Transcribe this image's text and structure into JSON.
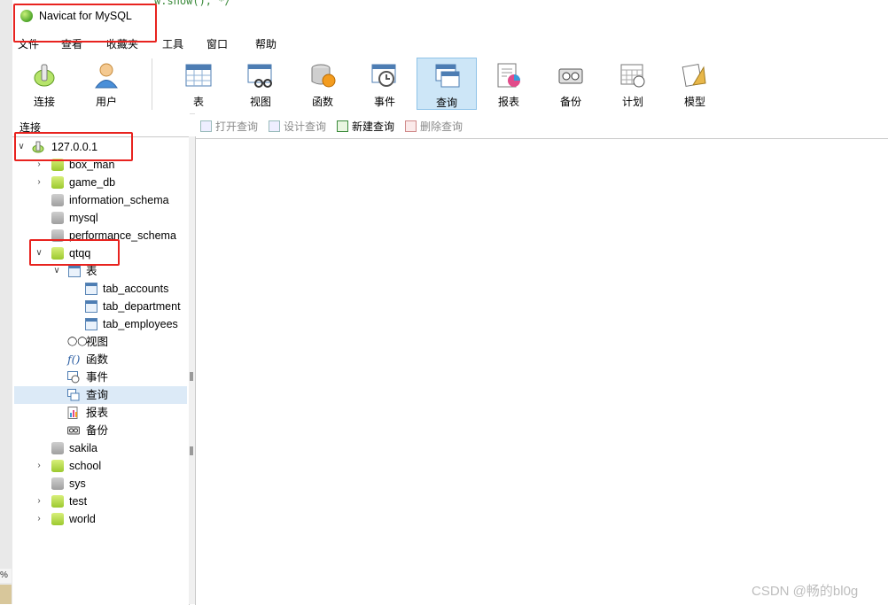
{
  "window": {
    "title": "Navicat for MySQL",
    "background_code": "w.show(); */"
  },
  "edge": {
    "badge": "%"
  },
  "menu": [
    "文件",
    "查看",
    "收藏夹",
    "工具",
    "窗口",
    "帮助"
  ],
  "toolbar": [
    {
      "label": "连接",
      "icon": "connection-icon"
    },
    {
      "label": "用户",
      "icon": "user-icon"
    },
    {
      "label": "表",
      "icon": "table-icon"
    },
    {
      "label": "视图",
      "icon": "view-icon"
    },
    {
      "label": "函数",
      "icon": "function-icon"
    },
    {
      "label": "事件",
      "icon": "event-icon"
    },
    {
      "label": "查询",
      "icon": "query-icon",
      "active": true
    },
    {
      "label": "报表",
      "icon": "report-icon"
    },
    {
      "label": "备份",
      "icon": "backup-icon"
    },
    {
      "label": "计划",
      "icon": "schedule-icon"
    },
    {
      "label": "模型",
      "icon": "model-icon"
    }
  ],
  "connection_pane": {
    "header": "连接"
  },
  "object_toolbar": [
    {
      "label": "打开查询",
      "enabled": false
    },
    {
      "label": "设计查询",
      "enabled": false
    },
    {
      "label": "新建查询",
      "enabled": true
    },
    {
      "label": "删除查询",
      "enabled": false
    }
  ],
  "tree": {
    "connection": "127.0.0.1",
    "databases": [
      {
        "name": "box_man",
        "expandable": true,
        "open": true
      },
      {
        "name": "game_db",
        "expandable": true,
        "open": true
      },
      {
        "name": "information_schema",
        "expandable": false,
        "open": false
      },
      {
        "name": "mysql",
        "expandable": false,
        "open": false
      },
      {
        "name": "performance_schema",
        "expandable": false,
        "open": false
      },
      {
        "name": "qtqq",
        "expandable": true,
        "open": true,
        "expanded": true
      }
    ],
    "qtqq_children": {
      "tables_label": "表",
      "tables": [
        "tab_accounts",
        "tab_department",
        "tab_employees"
      ],
      "others": [
        {
          "label": "视图",
          "icon": "view-glasses-icon"
        },
        {
          "label": "函数",
          "icon": "function-icon"
        },
        {
          "label": "事件",
          "icon": "event-icon"
        },
        {
          "label": "查询",
          "icon": "query-icon",
          "selected": true
        },
        {
          "label": "报表",
          "icon": "report-icon"
        },
        {
          "label": "备份",
          "icon": "backup-icon"
        }
      ]
    },
    "databases_after": [
      {
        "name": "sakila",
        "expandable": false,
        "open": false
      },
      {
        "name": "school",
        "expandable": true,
        "open": true
      },
      {
        "name": "sys",
        "expandable": false,
        "open": false
      },
      {
        "name": "test",
        "expandable": true,
        "open": true
      },
      {
        "name": "world",
        "expandable": true,
        "open": true
      }
    ]
  },
  "watermark": "CSDN @畅的bl0g",
  "colors": {
    "annotation": "#e8231f",
    "selection": "#dceaf7",
    "active_tool": "#cde6f7"
  }
}
